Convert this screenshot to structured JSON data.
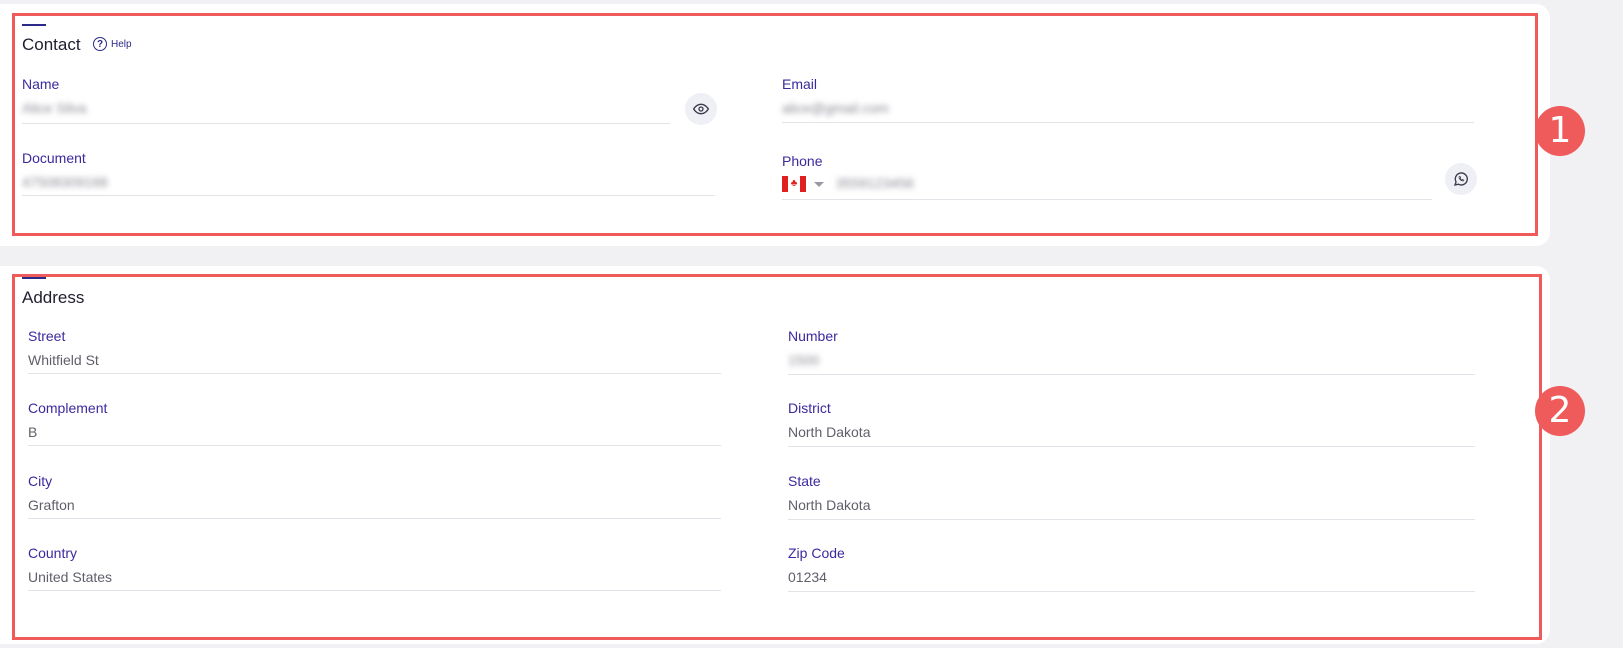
{
  "contact": {
    "title": "Contact",
    "help_label": "Help",
    "help_icon": "question-circle-icon",
    "fields": {
      "name": {
        "label": "Name",
        "value": "Alice Silva"
      },
      "email": {
        "label": "Email",
        "value": "alice@gmail.com"
      },
      "document": {
        "label": "Document",
        "value": "47508309168"
      },
      "phone": {
        "label": "Phone",
        "value": "3559123456",
        "country": "CA",
        "flag_icon": "canada-flag-icon"
      }
    },
    "reveal_icon": "eye-icon",
    "whatsapp_icon": "whatsapp-icon"
  },
  "address": {
    "title": "Address",
    "fields": {
      "street": {
        "label": "Street",
        "value": "Whitfield St"
      },
      "number": {
        "label": "Number",
        "value": "1500"
      },
      "complement": {
        "label": "Complement",
        "value": "B"
      },
      "district": {
        "label": "District",
        "value": "North Dakota"
      },
      "city": {
        "label": "City",
        "value": "Grafton"
      },
      "state": {
        "label": "State",
        "value": "North Dakota"
      },
      "country": {
        "label": "Country",
        "value": "United States"
      },
      "zip": {
        "label": "Zip Code",
        "value": "01234"
      }
    }
  },
  "annotations": {
    "one": "1",
    "two": "2"
  },
  "colors": {
    "accent": "#2b2a88",
    "label": "#3a2a9e",
    "highlight": "#ef5b5b"
  }
}
